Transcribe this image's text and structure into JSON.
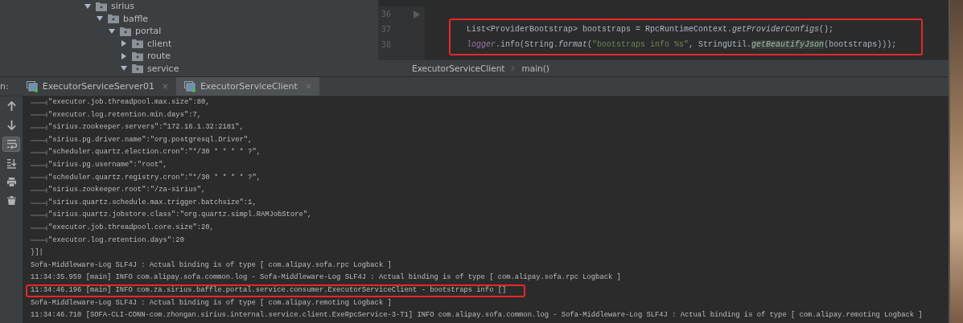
{
  "project_tree": {
    "items": [
      {
        "label": "sirius",
        "expanded": true,
        "children": [
          {
            "label": "baffle",
            "expanded": true,
            "children": [
              {
                "label": "portal",
                "expanded": true,
                "children": [
                  {
                    "label": "client",
                    "expanded": false
                  },
                  {
                    "label": "route",
                    "expanded": false
                  },
                  {
                    "label": "service",
                    "expanded": true
                  }
                ]
              }
            ]
          }
        ]
      }
    ]
  },
  "editor": {
    "lines": [
      {
        "number": "36",
        "kind": "fold"
      }
    ],
    "highlighted_lines": [
      {
        "number": "37",
        "tokens": [
          {
            "kind": "plain",
            "text": "List<ProviderBootstrap> bootstraps  = RpcRuntimeContext."
          },
          {
            "kind": "method",
            "text": "getProviderConfigs"
          },
          {
            "kind": "plain",
            "text": "();"
          }
        ]
      },
      {
        "number": "38",
        "tokens": [
          {
            "kind": "field",
            "text": "logger"
          },
          {
            "kind": "plain",
            "text": ".info(String."
          },
          {
            "kind": "method",
            "text": "format"
          },
          {
            "kind": "plain",
            "text": "("
          },
          {
            "kind": "string",
            "text": "\"bootstraps info %s\""
          },
          {
            "kind": "plain",
            "text": ", StringUtil."
          },
          {
            "kind": "usage",
            "text": "getBeautifyJson"
          },
          {
            "kind": "plain",
            "text": "(bootstraps)));"
          }
        ]
      }
    ],
    "breadcrumb": [
      "ExecutorServiceClient",
      "main()"
    ]
  },
  "run_panel": {
    "prefix": "n:",
    "tabs": [
      {
        "label": "ExecutorServiceServer01",
        "selected": false
      },
      {
        "label": "ExecutorServiceClient",
        "selected": true
      }
    ],
    "tools": [
      {
        "kind": "up",
        "on": false
      },
      {
        "kind": "down",
        "on": false
      },
      {
        "kind": "wrap",
        "on": true
      },
      {
        "kind": "scroll-end",
        "on": false
      },
      {
        "kind": "print",
        "on": false
      },
      {
        "kind": "delete",
        "on": false
      }
    ],
    "log": [
      {
        "kind": "entry",
        "text": "\"executor.job.threadpool.max.size\":80,"
      },
      {
        "kind": "entry",
        "text": "\"executor.log.retention.min.days\":7,"
      },
      {
        "kind": "entry",
        "text": "\"sirius.zookeeper.servers\":\"172.16.1.32:2181\","
      },
      {
        "kind": "entry",
        "text": "\"sirius.pg.driver.name\":\"org.postgresql.Driver\","
      },
      {
        "kind": "entry",
        "text": "\"scheduler.quartz.election.cron\":\"*/30 * * * * ?\","
      },
      {
        "kind": "entry",
        "text": "\"sirius.pg.username\":\"root\","
      },
      {
        "kind": "entry",
        "text": "\"scheduler.quartz.registry.cron\":\"*/30 * * * * ?\","
      },
      {
        "kind": "entry",
        "text": "\"sirius.zookeeper.root\":\"/za-sirius\","
      },
      {
        "kind": "entry",
        "text": "\"sirius.quartz.schedule.max.trigger.batchsize\":1,"
      },
      {
        "kind": "entry",
        "text": "\"sirius.quartz.jobstore.class\":\"org.quartz.simpl.RAMJobStore\","
      },
      {
        "kind": "entry",
        "text": "\"executor.job.threadpool.core.size\":20,"
      },
      {
        "kind": "entry",
        "text": "\"executor.log.retention.days\":20"
      },
      {
        "kind": "plain",
        "text": "}]|"
      },
      {
        "kind": "plain",
        "text": "Sofa-Middleware-Log SLF4J : Actual binding is of type [ com.alipay.sofa.rpc Logback ]"
      },
      {
        "kind": "plain",
        "text": "11:34:35.959 [main] INFO com.alipay.sofa.common.log - Sofa-Middleware-Log SLF4J : Actual binding is of type [ com.alipay.sofa.rpc Logback ]"
      },
      {
        "kind": "marked",
        "text": "11:34:46.196 [main] INFO com.za.sirius.baffle.portal.service.consumer.ExecutorServiceClient - bootstraps info []"
      },
      {
        "kind": "plain",
        "text": "Sofa-Middleware-Log SLF4J : Actual binding is of type [ com.alipay.remoting Logback ]"
      },
      {
        "kind": "plain",
        "text": "11:34:46.710 [SOFA-CLI-CONN-com.zhongan.sirius.internal.service.client.ExeRpcService-3-T1] INFO com.alipay.sofa.common.log - Sofa-Middleware-Log SLF4J : Actual binding is of type [ com.alipay.remoting Logback ]"
      }
    ]
  }
}
